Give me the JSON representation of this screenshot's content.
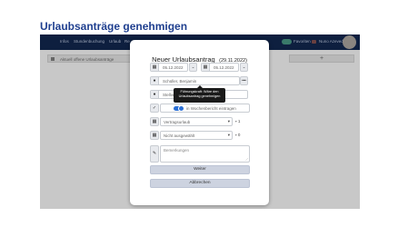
{
  "page": {
    "title": "Urlaubsanträge genehmigen"
  },
  "navbar": {
    "items": [
      "Infos",
      "Stundenbuchung",
      "Urlaub",
      "Re"
    ],
    "right_text": "Favoriten",
    "user_name": "Nuno Azevedo"
  },
  "toolbar": {
    "left_label": "Aktuell offene Urlaubsanträge",
    "right_symbol": "+"
  },
  "modal": {
    "title": "Neuer Urlaubsantrag",
    "title_date": "(29.11.2022)",
    "date_from": "05.12.2022",
    "date_to": "05.12.2022",
    "approver_placeholder": "Schüller, Benjamin",
    "approver_more": "•••",
    "substitute_placeholder": "Stellvertretung",
    "tooltip_text": "Führungskraft: Wäre den Urlaubsantrag genehmigen",
    "weekly_report_label": "in Wochenbericht eintragen",
    "weekly_report_enabled": true,
    "leave_type": "Vertragsurlaub",
    "leave_type_count": "1",
    "special_type": "Nicht ausgewählt",
    "special_type_count": "0",
    "remarks_placeholder": "Bemerkungen",
    "next_button": "Weiter",
    "cancel_button": "Abbrechen"
  },
  "icons": {
    "calendar": "calendar-icon",
    "person": "person-icon",
    "check": "check-icon",
    "pencil": "pencil-icon"
  },
  "colors": {
    "title_blue": "#1f3f8f",
    "navbar": "#0e1f3f",
    "toggle_blue": "#2a6fd6",
    "button": "#cdd3e0"
  }
}
